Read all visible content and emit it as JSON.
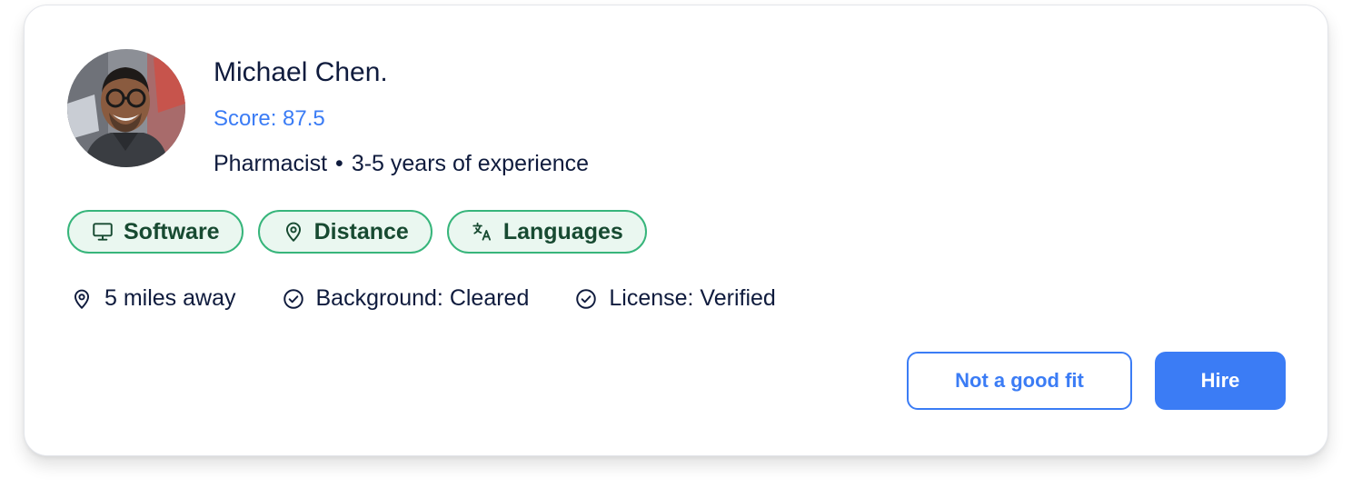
{
  "candidate": {
    "name": "Michael Chen.",
    "score": "Score: 87.5",
    "role": "Pharmacist",
    "experience": "3-5 years of experience",
    "separator": "•"
  },
  "tags": [
    {
      "label": "Software",
      "icon": "monitor-icon"
    },
    {
      "label": "Distance",
      "icon": "map-pin-icon"
    },
    {
      "label": "Languages",
      "icon": "translate-icon"
    }
  ],
  "details": [
    {
      "label": "5 miles away",
      "icon": "map-pin-icon"
    },
    {
      "label": "Background: Cleared",
      "icon": "check-circle-icon"
    },
    {
      "label": "License: Verified",
      "icon": "check-circle-icon"
    }
  ],
  "actions": {
    "reject_label": "Not a good fit",
    "hire_label": "Hire"
  },
  "colors": {
    "accent": "#3b7cf5",
    "tag_border": "#37b57b",
    "tag_fill": "#eaf7f0",
    "tag_text": "#174a31",
    "text": "#0f1b3d"
  }
}
